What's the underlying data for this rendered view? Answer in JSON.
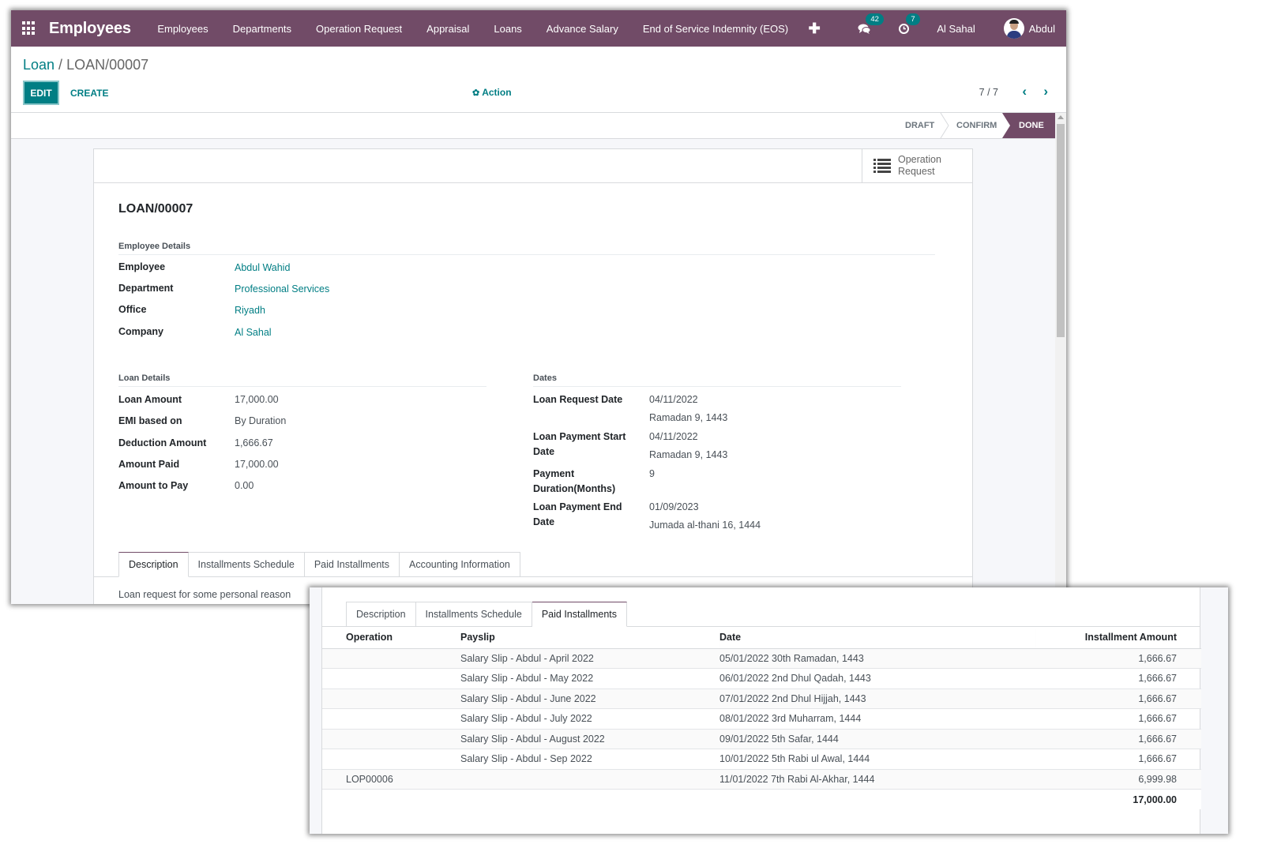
{
  "navbar": {
    "app_title": "Employees",
    "menu": [
      "Employees",
      "Departments",
      "Operation Request",
      "Appraisal",
      "Loans",
      "Advance Salary",
      "End of Service Indemnity (EOS)"
    ],
    "messages_count": "42",
    "activities_count": "7",
    "company": "Al Sahal",
    "user": "Abdul",
    "icons": {
      "apps": "apps-grid-icon",
      "add": "plus-icon",
      "messages": "chat-icon",
      "activities": "clock-icon"
    }
  },
  "breadcrumb": {
    "parent": "Loan",
    "separator": " / ",
    "current": "LOAN/00007"
  },
  "toolbar": {
    "edit": "EDIT",
    "create": "CREATE",
    "action": "Action",
    "pager": "7 / 7"
  },
  "statusbar": {
    "states": [
      "DRAFT",
      "CONFIRM",
      "DONE"
    ],
    "active": "DONE",
    "accent": "#714b67"
  },
  "smart_button": {
    "line1": "Operation",
    "line2": "Request"
  },
  "record": {
    "name": "LOAN/00007",
    "employee_details": {
      "title": "Employee Details",
      "fields": [
        {
          "label": "Employee",
          "value": "Abdul Wahid"
        },
        {
          "label": "Department",
          "value": "Professional Services"
        },
        {
          "label": "Office",
          "value": "Riyadh"
        },
        {
          "label": "Company",
          "value": "Al Sahal"
        }
      ]
    },
    "loan_details": {
      "title": "Loan Details",
      "fields": [
        {
          "label": "Loan Amount",
          "value": "17,000.00"
        },
        {
          "label": "EMI based on",
          "value": "By Duration"
        },
        {
          "label": "Deduction Amount",
          "value": "1,666.67"
        },
        {
          "label": "Amount Paid",
          "value": "17,000.00"
        },
        {
          "label": "Amount to Pay",
          "value": "0.00"
        }
      ]
    },
    "dates": {
      "title": "Dates",
      "fields": [
        {
          "label1": "Loan Request Date",
          "label2": "",
          "value": "04/11/2022",
          "hijri": "Ramadan 9, 1443"
        },
        {
          "label1": "Loan Payment Start",
          "label2": "Date",
          "value": "04/11/2022",
          "hijri": "Ramadan 9, 1443"
        },
        {
          "label1": "Payment",
          "label2": "Duration(Months)",
          "value": "9",
          "hijri": ""
        },
        {
          "label1": "Loan Payment End",
          "label2": "Date",
          "value": "01/09/2023",
          "hijri": "Jumada al-thani 16, 1444"
        }
      ]
    }
  },
  "tabs": [
    "Description",
    "Installments Schedule",
    "Paid Installments",
    "Accounting Information"
  ],
  "description_text": "Loan request for some personal reason",
  "overlay": {
    "tabs": [
      "Description",
      "Installments Schedule",
      "Paid Installments"
    ],
    "active_tab": "Paid Installments",
    "columns": [
      "Operation",
      "Payslip",
      "Date",
      "Installment Amount"
    ],
    "rows": [
      {
        "operation": "",
        "payslip": "Salary Slip - Abdul - April 2022",
        "date": "05/01/2022 30th Ramadan, 1443",
        "amount": "1,666.67"
      },
      {
        "operation": "",
        "payslip": "Salary Slip - Abdul - May 2022",
        "date": "06/01/2022 2nd Dhul Qadah, 1443",
        "amount": "1,666.67"
      },
      {
        "operation": "",
        "payslip": "Salary Slip - Abdul - June 2022",
        "date": "07/01/2022 2nd Dhul Hijjah, 1443",
        "amount": "1,666.67"
      },
      {
        "operation": "",
        "payslip": "Salary Slip - Abdul - July 2022",
        "date": "08/01/2022 3rd Muharram, 1444",
        "amount": "1,666.67"
      },
      {
        "operation": "",
        "payslip": "Salary Slip - Abdul - August 2022",
        "date": "09/01/2022 5th Safar, 1444",
        "amount": "1,666.67"
      },
      {
        "operation": "",
        "payslip": "Salary Slip - Abdul - Sep 2022",
        "date": "10/01/2022 5th Rabi ul Awal, 1444",
        "amount": "1,666.67"
      },
      {
        "operation": "LOP00006",
        "payslip": "",
        "date": "11/01/2022 7th Rabi Al-Akhar, 1444",
        "amount": "6,999.98"
      }
    ],
    "total": "17,000.00"
  }
}
